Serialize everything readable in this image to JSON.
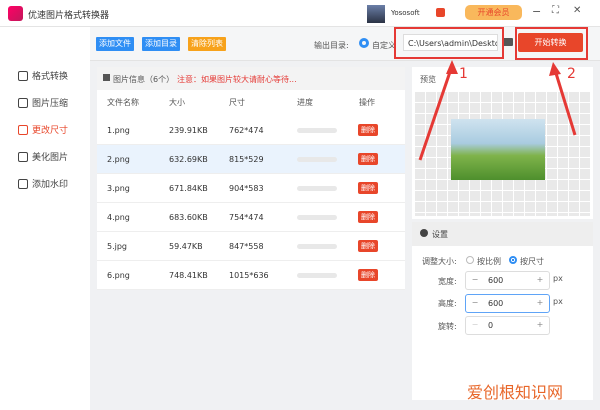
{
  "app": {
    "title": "优速图片格式转换器",
    "user": "Yososoft",
    "vip_label": "开通会员"
  },
  "sidebar": {
    "items": [
      {
        "label": "格式转换",
        "icon": "convert-icon"
      },
      {
        "label": "图片压缩",
        "icon": "compress-icon"
      },
      {
        "label": "更改尺寸",
        "icon": "resize-icon",
        "active": true
      },
      {
        "label": "美化图片",
        "icon": "beautify-icon"
      },
      {
        "label": "添加水印",
        "icon": "watermark-icon"
      }
    ]
  },
  "toolbar": {
    "add_file": "添加文件",
    "add_folder": "添加目录",
    "clear_list": "清除列表",
    "output_label": "输出目录:",
    "custom_label": "自定义",
    "output_path": "C:\\Users\\admin\\Deskto",
    "start": "开始转换"
  },
  "list": {
    "info": "图片信息（6个）",
    "notice": "注意：如果图片较大请耐心等待...",
    "headers": [
      "文件名称",
      "大小",
      "尺寸",
      "进度",
      "操作"
    ],
    "delete_label": "删除",
    "rows": [
      {
        "name": "1.png",
        "size": "239.91KB",
        "dim": "762*474"
      },
      {
        "name": "2.png",
        "size": "632.69KB",
        "dim": "815*529"
      },
      {
        "name": "3.png",
        "size": "671.84KB",
        "dim": "904*583"
      },
      {
        "name": "4.png",
        "size": "683.60KB",
        "dim": "754*474"
      },
      {
        "name": "5.jpg",
        "size": "59.47KB",
        "dim": "847*558"
      },
      {
        "name": "6.png",
        "size": "748.41KB",
        "dim": "1015*636"
      }
    ]
  },
  "preview": {
    "title": "预览"
  },
  "settings": {
    "title": "设置",
    "resize_label": "调整大小:",
    "opt_ratio": "按比例",
    "opt_size": "按尺寸",
    "width_label": "宽度:",
    "width": "600",
    "height_label": "高度:",
    "height": "600",
    "rotate_label": "旋转:",
    "rotate": "0",
    "unit": "px",
    "minus": "−",
    "plus": "+"
  },
  "annotations": {
    "a1": "1",
    "a2": "2"
  },
  "watermark": "爱创根知识网",
  "colors": {
    "accent": "#e8462a",
    "blue": "#2f8ef4",
    "orange": "#f7a21b"
  }
}
